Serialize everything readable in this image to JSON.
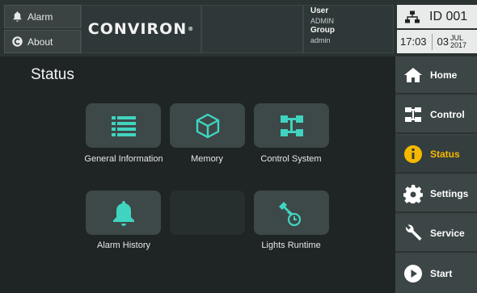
{
  "topbar": {
    "alarm_label": "Alarm",
    "about_label": "About",
    "logo_text": "CONVIRON",
    "logo_mark": "®",
    "user_label": "User",
    "user_value": "ADMIN",
    "group_label": "Group",
    "group_value": "admin",
    "id_label": "ID",
    "id_value": "001",
    "time": "17:03",
    "day": "03",
    "month": "JUL",
    "year": "2017"
  },
  "page": {
    "title": "Status"
  },
  "tiles": [
    {
      "label": "General Information",
      "icon": "list-icon"
    },
    {
      "label": "Memory",
      "icon": "cube-icon"
    },
    {
      "label": "Control System",
      "icon": "control-system-icon"
    },
    {
      "label": "Alarm History",
      "icon": "bell-icon"
    },
    {
      "label": "",
      "icon": ""
    },
    {
      "label": "Lights Runtime",
      "icon": "lights-runtime-icon"
    }
  ],
  "nav": [
    {
      "label": "Home",
      "icon": "home-icon"
    },
    {
      "label": "Control",
      "icon": "control-icon"
    },
    {
      "label": "Status",
      "icon": "info-icon",
      "active": true
    },
    {
      "label": "Settings",
      "icon": "gear-icon"
    },
    {
      "label": "Service",
      "icon": "wrench-icon"
    },
    {
      "label": "Start",
      "icon": "play-icon"
    }
  ],
  "colors": {
    "accent": "#f7b800",
    "tile_icon": "#40d4c0",
    "background": "#1f2424"
  }
}
